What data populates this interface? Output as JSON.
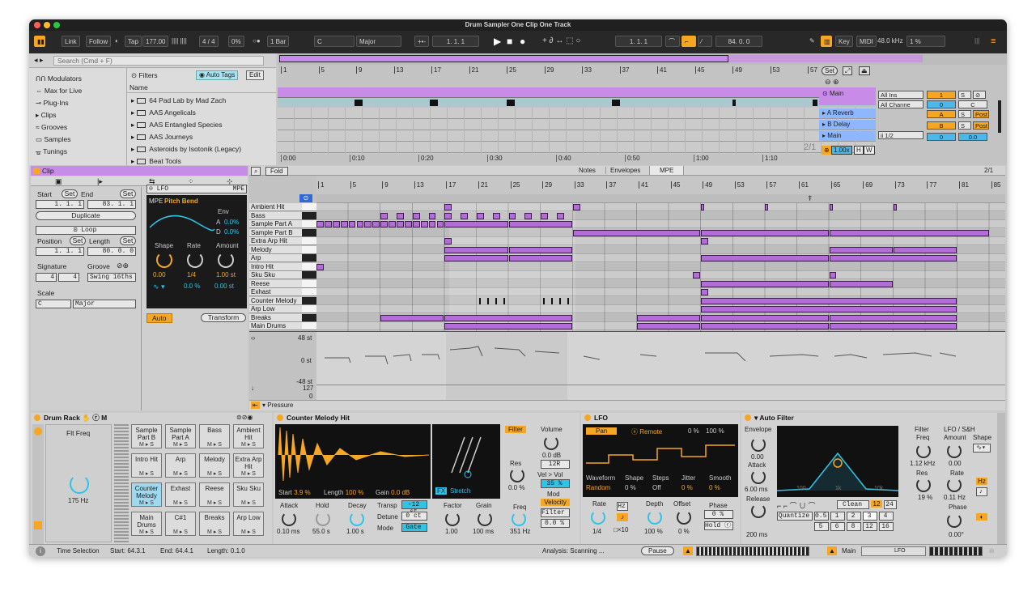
{
  "window": {
    "title": "Drum Sampler One Clip One Track"
  },
  "control_bar": {
    "link": "Link",
    "follow": "Follow",
    "tap": "Tap",
    "tempo": "177.00",
    "time_sig": "4 / 4",
    "groove_pct": "0%",
    "quantize": "1 Bar",
    "key_root": "C",
    "scale": "Major",
    "arr_position": "1.  1.  1",
    "loop_start": "1.  1.  1",
    "loop_length": "84.  0.  0",
    "key": "Key",
    "midi": "MIDI",
    "sample_rate": "48.0 kHz",
    "cpu": "1 %"
  },
  "browser": {
    "search_placeholder": "Search (Cmd + F)",
    "filters": "Filters",
    "auto_tags": "Auto Tags",
    "edit": "Edit",
    "name_header": "Name",
    "sidebar": [
      "Modulators",
      "Max for Live",
      "Plug-Ins",
      "Clips",
      "Grooves",
      "Samples",
      "Tunings"
    ],
    "items": [
      "64 Pad Lab by Mad Zach",
      "AAS Angelicals",
      "AAS Entangled Species",
      "AAS Journeys",
      "Asteroids by Isotonik (Legacy)",
      "Beat Tools"
    ]
  },
  "arrangement": {
    "bars": [
      "1",
      "5",
      "9",
      "13",
      "17",
      "21",
      "25",
      "29",
      "33",
      "37",
      "41",
      "45",
      "49",
      "53",
      "57"
    ],
    "times": [
      "0:00",
      "0:10",
      "0:20",
      "0:30",
      "0:40",
      "0:50",
      "1:00",
      "1:10"
    ],
    "set_label": "Set",
    "page": "2/1",
    "zoom": "1.00x",
    "h": "H",
    "w": "W",
    "tracks": [
      {
        "name": "Main",
        "io": "All Ins",
        "ch": "All Channe",
        "num": "1",
        "s": "S"
      },
      {
        "name": "A Reverb",
        "num": "A",
        "s": "S",
        "post": "Post"
      },
      {
        "name": "B Delay",
        "num": "B",
        "s": "S",
        "post": "Post"
      },
      {
        "name": "Main",
        "io": "ii 1/2",
        "num": "0",
        "vol": "0.0"
      }
    ],
    "mix_c": "C"
  },
  "clip": {
    "title": "Clip",
    "start_label": "Start",
    "end_label": "End",
    "set": "Set",
    "start": "1.  1.  1",
    "end": "83.  1.  1",
    "duplicate": "Duplicate",
    "loop": "Loop",
    "position_label": "Position",
    "length_label": "Length",
    "position": "1.  1.  1",
    "length": "80.  0.  0",
    "signature_label": "Signature",
    "groove_label": "Groove",
    "sig_num": "4",
    "sig_den": "4",
    "groove": "Swing 16ths",
    "scale_label": "Scale",
    "scale_root": "C",
    "scale_name": "Major",
    "mod": {
      "source": "LFO",
      "mode": "MPE",
      "mpe": "MPE",
      "target": "Pitch Bend",
      "env": "Env",
      "a": "A",
      "a_val": "0.0%",
      "d": "D",
      "d_val": "0.0%",
      "shape": "Shape",
      "rate": "Rate",
      "amount": "Amount",
      "shape_val": "0.00",
      "rate_val": "1/4",
      "amount_val": "1.00 st",
      "v1": "0.0 %",
      "v2": "0.00 st"
    },
    "auto": "Auto",
    "transform": "Transform"
  },
  "midi": {
    "fold": "Fold",
    "tabs": [
      "Notes",
      "Envelopes",
      "MPE"
    ],
    "page": "2/1",
    "bars": [
      "1",
      "5",
      "9",
      "13",
      "17",
      "21",
      "25",
      "29",
      "33",
      "37",
      "41",
      "45",
      "49",
      "53",
      "57",
      "61",
      "65",
      "69",
      "73",
      "77",
      "81",
      "85"
    ],
    "lanes": [
      "Ambient Hit",
      "Bass",
      "Sample Part A",
      "Sample Part B",
      "Extra Arp Hit",
      "Melody",
      "Arp",
      "Intro Hit",
      "Sku Sku",
      "Reese",
      "Exhast",
      "Counter Melody",
      "Arp Low",
      "Breaks",
      "Main Drums"
    ],
    "env_labels": [
      "48 st",
      "0 st",
      "-48 st",
      "127",
      "0"
    ],
    "pressure": "Pressure"
  },
  "drum_rack": {
    "title": "Drum Rack",
    "m": "M",
    "macro": "Flt Freq",
    "macro_val": "175 Hz",
    "pads": [
      [
        "Sample Part B",
        "Sample Part A",
        "Bass",
        "Ambient Hit"
      ],
      [
        "Intro Hit",
        "Arp",
        "Melody",
        "Extra Arp Hit"
      ],
      [
        "Counter Melody",
        "Exhast",
        "Reese",
        "Sku Sku"
      ],
      [
        "Main Drums",
        "C#1",
        "Breaks",
        "Arp Low"
      ]
    ]
  },
  "sampler": {
    "title": "Counter Melody Hit",
    "start": "Start",
    "start_val": "3.9 %",
    "length": "Length",
    "length_val": "100 %",
    "gain": "Gain",
    "gain_val": "0.0 dB",
    "fx": "FX",
    "stretch": "Stretch",
    "filter": "Filter",
    "volume": "Volume",
    "vol_val": "0.0 dB",
    "pan_val": "12R",
    "res": "Res",
    "res_val": "0.0 %",
    "vel_vol": "Vel > Vol",
    "vel_vol_val": "35 %",
    "mod": "Mod",
    "velocity": "Velocity",
    "filter_sel": "Filter",
    "filter_amt": "0.0 %",
    "freq": "Freq",
    "freq_val": "351 Hz",
    "attack": "Attack",
    "attack_val": "0.10 ms",
    "hold": "Hold",
    "hold_val": "55.0 s",
    "decay": "Decay",
    "decay_val": "1.00 s",
    "transp": "Transp",
    "transp_val": "-12 st",
    "detune": "Detune",
    "detune_val": "0 ct",
    "mode": "Mode",
    "mode_val": "Gate",
    "factor": "Factor",
    "factor_val": "1.00",
    "grain": "Grain",
    "grain_val": "100 ms"
  },
  "lfo": {
    "title": "LFO",
    "pan": "Pan",
    "remote": "Remote",
    "pct1": "0 %",
    "pct2": "100 %",
    "waveform": "Waveform",
    "waveform_val": "Random",
    "shape": "Shape",
    "shape_val": "0 %",
    "steps": "Steps",
    "steps_val": "Off",
    "jitter": "Jitter",
    "jitter_val": "0 %",
    "smooth": "Smooth",
    "smooth_val": "0 %",
    "rate": "Rate",
    "rate_val": "1/4",
    "hz": "Hz",
    "x10": "×10",
    "depth": "Depth",
    "depth_val": "100 %",
    "offset": "Offset",
    "offset_val": "0 %",
    "phase": "Phase",
    "phase_val": "0 %",
    "hold": "Hold",
    "r": "R"
  },
  "autofilter": {
    "title": "Auto Filter",
    "envelope": "Envelope",
    "env_val": "0.00",
    "attack": "Attack",
    "attack_val": "6.00 ms",
    "release": "Release",
    "release_val": "200 ms",
    "quantize": "Quantize",
    "q_vals": [
      "0.5",
      "1",
      "2",
      "3",
      "4",
      "5",
      "6",
      "8",
      "12",
      "16"
    ],
    "clean": "Clean",
    "n12": "12",
    "n24": "24",
    "f100": "100",
    "f1k": "1k",
    "f10k": "10k",
    "filter": "Filter",
    "freq": "Freq",
    "freq_val": "1.12 kHz",
    "res": "Res",
    "res_val": "19 %",
    "lfo": "LFO / S&H",
    "amount": "Amount",
    "shape": "Shape",
    "amount_val": "0.00",
    "rate": "Rate",
    "rate_val": "0.11 Hz",
    "phase": "Phase",
    "phase_val": "0.00°"
  },
  "status": {
    "selection": "Time Selection",
    "start": "Start: 64.3.1",
    "end": "End: 64.4.1",
    "length": "Length: 0.1.0",
    "analysis": "Analysis: Scanning ...",
    "pause": "Pause",
    "main": "Main",
    "lfo": "LFO"
  },
  "colors": {
    "accent": "#f5a623",
    "clip": "#b46cd8",
    "track_blue": "#8fb7ff",
    "arr_bar": "#c88be8"
  }
}
